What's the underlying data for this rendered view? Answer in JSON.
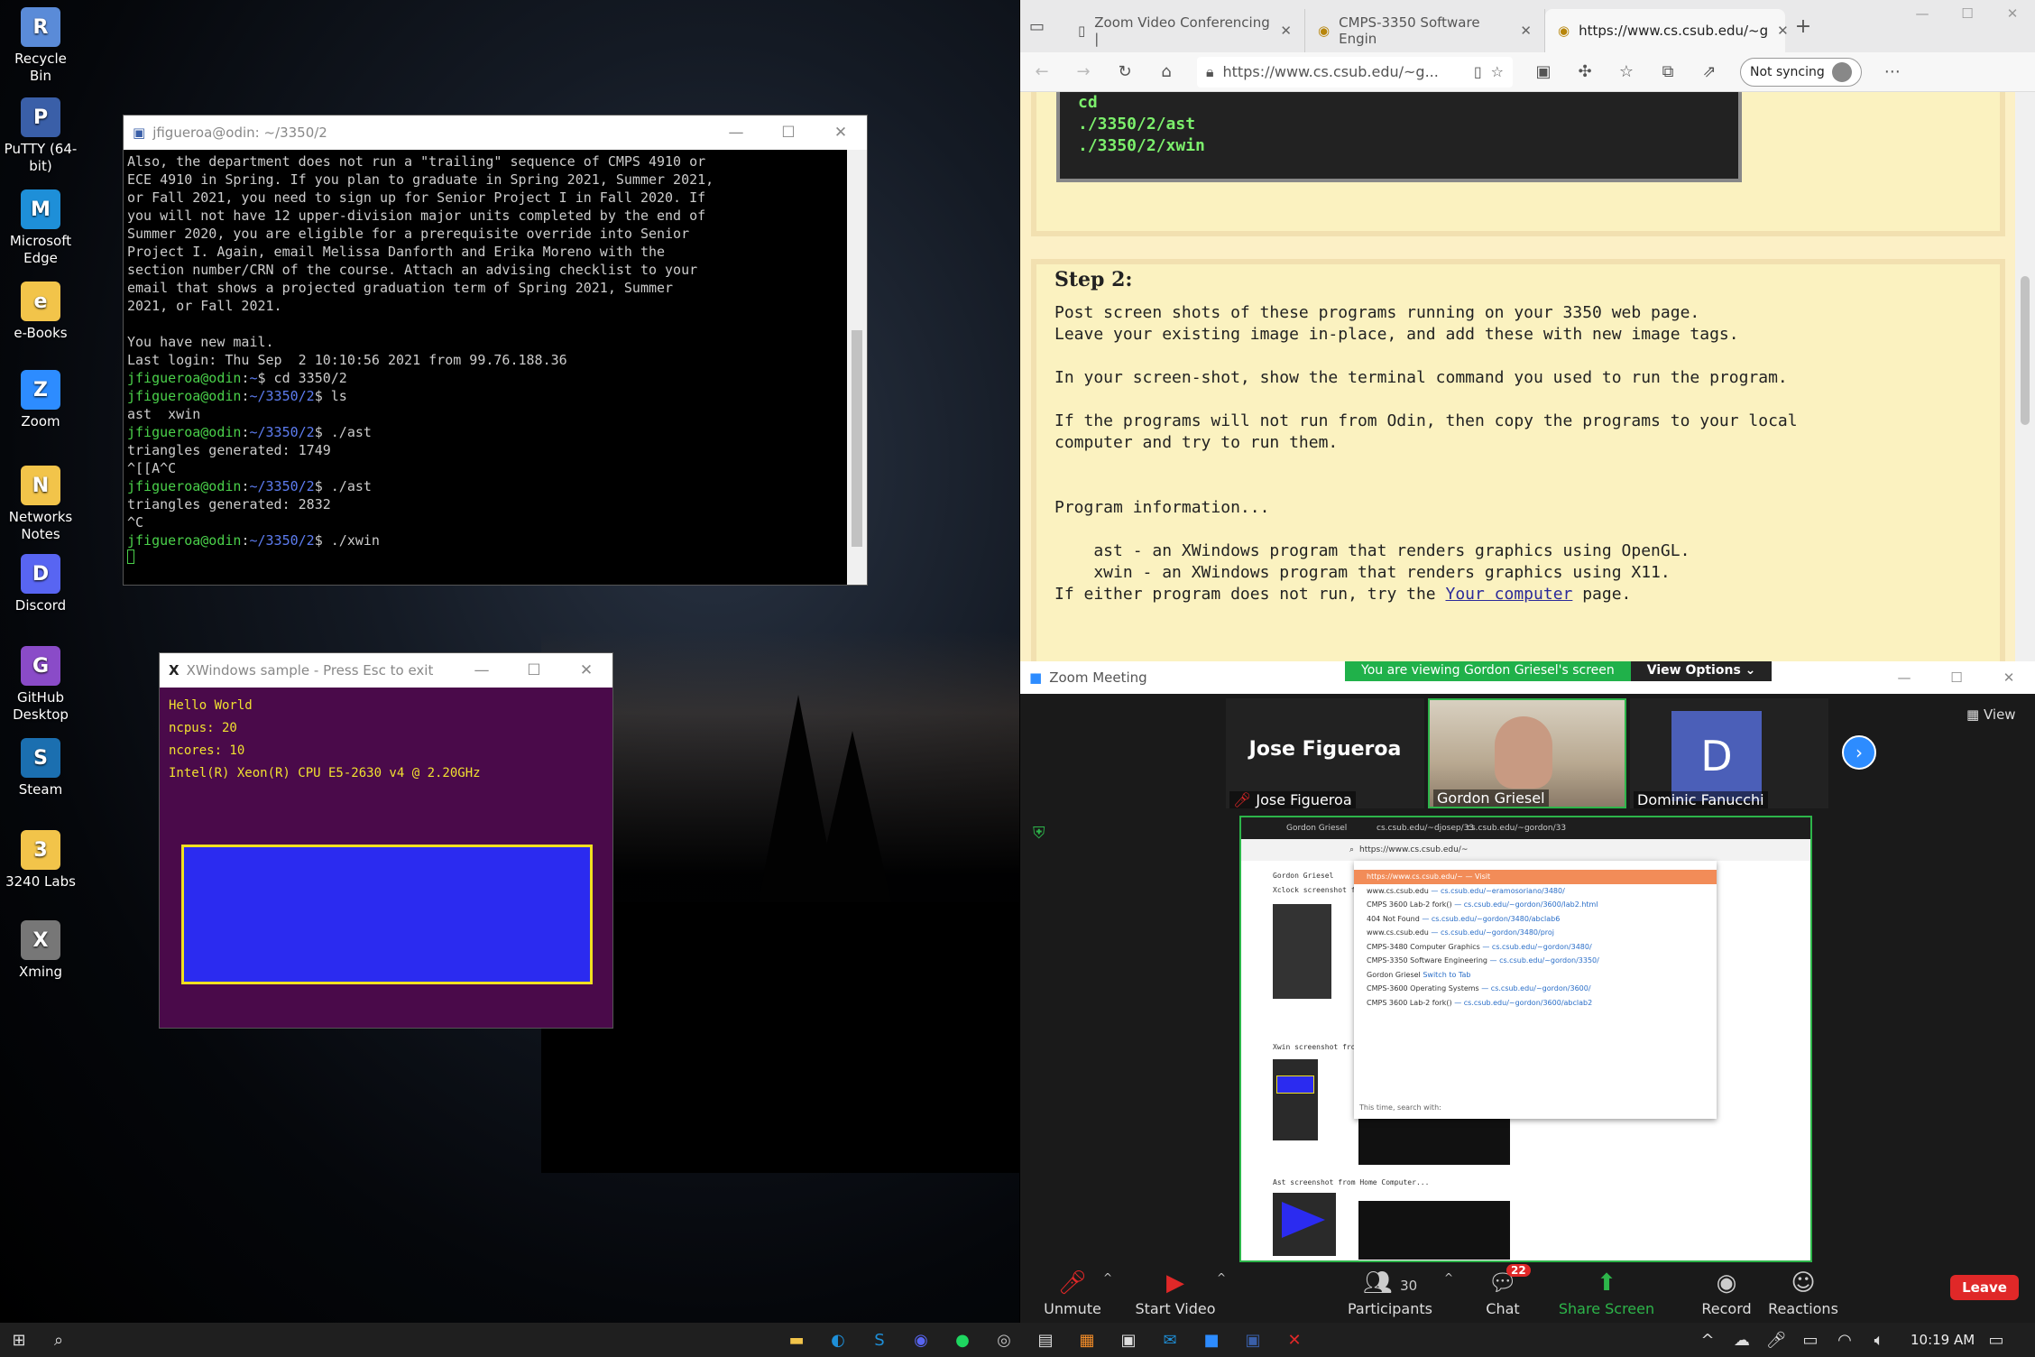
{
  "desktop": {
    "icons": [
      {
        "label": "Recycle Bin",
        "icon": "recycle-bin-icon",
        "color": "#5a8bd8"
      },
      {
        "label": "PuTTY (64-bit)",
        "icon": "putty-icon",
        "color": "#3a5fa8"
      },
      {
        "label": "Microsoft Edge",
        "icon": "edge-icon",
        "color": "#1e8fd8"
      },
      {
        "label": "e-Books",
        "icon": "folder-icon",
        "color": "#f2c44a"
      },
      {
        "label": "Zoom",
        "icon": "zoom-icon",
        "color": "#2d8cff"
      },
      {
        "label": "Networks Notes",
        "icon": "folder-icon",
        "color": "#f2c44a"
      },
      {
        "label": "Discord",
        "icon": "discord-icon",
        "color": "#5865f2"
      },
      {
        "label": "GitHub Desktop",
        "icon": "github-icon",
        "color": "#8a4bc8"
      },
      {
        "label": "Steam",
        "icon": "steam-icon",
        "color": "#1b6fb0"
      },
      {
        "label": "3240 Labs",
        "icon": "folder-icon",
        "color": "#f2c44a"
      },
      {
        "label": "Xming",
        "icon": "xming-icon",
        "color": "#777777"
      }
    ]
  },
  "putty": {
    "title": "jfigueroa@odin: ~/3350/2",
    "lines": [
      "Also, the department does not run a \"trailing\" sequence of CMPS 4910 or",
      "ECE 4910 in Spring. If you plan to graduate in Spring 2021, Summer 2021,",
      "or Fall 2021, you need to sign up for Senior Project I in Fall 2020. If",
      "you will not have 12 upper-division major units completed by the end of",
      "Summer 2020, you are eligible for a prerequisite override into Senior",
      "Project I. Again, email Melissa Danforth and Erika Moreno with the",
      "section number/CRN of the course. Attach an advising checklist to your",
      "email that shows a projected graduation term of Spring 2021, Summer",
      "2021, or Fall 2021.",
      "",
      "You have new mail.",
      "Last login: Thu Sep  2 10:10:56 2021 from 99.76.188.36"
    ],
    "prompt_user": "jfigueroa@odin",
    "session": [
      {
        "type": "prompt",
        "dir": "~",
        "cmd": "cd 3350/2"
      },
      {
        "type": "prompt",
        "dir": "~/3350/2",
        "cmd": "ls"
      },
      {
        "type": "out",
        "text": "ast  xwin"
      },
      {
        "type": "prompt",
        "dir": "~/3350/2",
        "cmd": "./ast"
      },
      {
        "type": "out",
        "text": "triangles generated: 1749"
      },
      {
        "type": "out",
        "text": "^[[A^C"
      },
      {
        "type": "prompt",
        "dir": "~/3350/2",
        "cmd": "./ast"
      },
      {
        "type": "out",
        "text": "triangles generated: 2832"
      },
      {
        "type": "out",
        "text": "^C"
      },
      {
        "type": "prompt",
        "dir": "~/3350/2",
        "cmd": "./xwin"
      }
    ]
  },
  "xwin": {
    "title": "XWindows sample  -   Press Esc to exit",
    "lines": [
      "Hello World",
      "ncpus: 20",
      "ncores: 10",
      "Intel(R) Xeon(R) CPU E5-2630 v4 @ 2.20GHz"
    ],
    "bg": "#4a0a4a",
    "rect_fill": "#2b2bf0",
    "rect_border": "#f0e020"
  },
  "edge": {
    "tabs": [
      {
        "label": "Zoom Video Conferencing |",
        "icon": "page-icon"
      },
      {
        "label": "CMPS-3350 Software Engin",
        "icon": "favicon-icon"
      },
      {
        "label": "https://www.cs.csub.edu/~g",
        "icon": "favicon-icon"
      }
    ],
    "url": "https://www.cs.csub.edu/~g...",
    "sync": "Not syncing",
    "cmd_lines": [
      "cd",
      "./3350/2/ast",
      "./3350/2/xwin"
    ],
    "step_title": "Step 2:",
    "step_lines": [
      "Post screen shots of these programs running on your 3350 web page.",
      "Leave your existing image in-place, and add these with new image tags.",
      "",
      "In your screen-shot, show the terminal command you used to run the program.",
      "",
      "If the programs will not run from Odin, then copy the programs to your local",
      "computer and try to run them.",
      "",
      "",
      "Program information...",
      "",
      "    ast - an XWindows program that renders graphics using OpenGL.",
      "    xwin - an XWindows program that renders graphics using X11.",
      ""
    ],
    "last_line_pre": "If either program does not run, try the ",
    "last_line_link": "Your computer",
    "last_line_post": " page."
  },
  "zoom": {
    "title": "Zoom Meeting",
    "banner": "You are viewing Gordon Griesel's screen",
    "view_options": "View Options",
    "view": "View",
    "participants_tiles": [
      {
        "display": "Jose Figueroa",
        "name": "Jose Figueroa"
      },
      {
        "display": "",
        "name": "Gordon Griesel"
      },
      {
        "display": "D",
        "name": "Dominic Fanucchi"
      }
    ],
    "shared": {
      "tabs": [
        "Gordon Griesel",
        "cs.csub.edu/~djosep/33",
        "cs.csub.edu/~gordon/33"
      ],
      "url": "https://www.cs.csub.edu/~",
      "page_header": "Gordon Griesel",
      "caption1": "Xclock screenshot f",
      "caption2": "Xwin screenshot fro",
      "caption3": "Ast screenshot from Home Computer...",
      "dropdown": [
        {
          "title": "https://www.cs.csub.edu/~",
          "url": "— Visit"
        },
        {
          "title": "www.cs.csub.edu",
          "url": "— cs.csub.edu/~eramosoriano/3480/"
        },
        {
          "title": "CMPS 3600 Lab-2 fork()",
          "url": "— cs.csub.edu/~gordon/3600/lab2.html"
        },
        {
          "title": "404 Not Found",
          "url": "— cs.csub.edu/~gordon/3480/abclab6"
        },
        {
          "title": "www.cs.csub.edu",
          "url": "— cs.csub.edu/~gordon/3480/proj"
        },
        {
          "title": "CMPS-3480 Computer Graphics",
          "url": "— cs.csub.edu/~gordon/3480/"
        },
        {
          "title": "CMPS-3350 Software Engineering",
          "url": "— cs.csub.edu/~gordon/3350/"
        },
        {
          "title": "Gordon Griesel",
          "url": "Switch to Tab"
        },
        {
          "title": "CMPS-3600 Operating Systems",
          "url": "— cs.csub.edu/~gordon/3600/"
        },
        {
          "title": "CMPS 3600 Lab-2 fork()",
          "url": "— cs.csub.edu/~gordon/3600/abclab2"
        }
      ],
      "search_with": "This time, search with:"
    },
    "toolbar": {
      "unmute": "Unmute",
      "start_video": "Start Video",
      "participants": "Participants",
      "participants_count": "30",
      "chat": "Chat",
      "chat_badge": "22",
      "share": "Share Screen",
      "record": "Record",
      "reactions": "Reactions",
      "leave": "Leave"
    }
  },
  "taskbar": {
    "time": "10:19 AM"
  }
}
